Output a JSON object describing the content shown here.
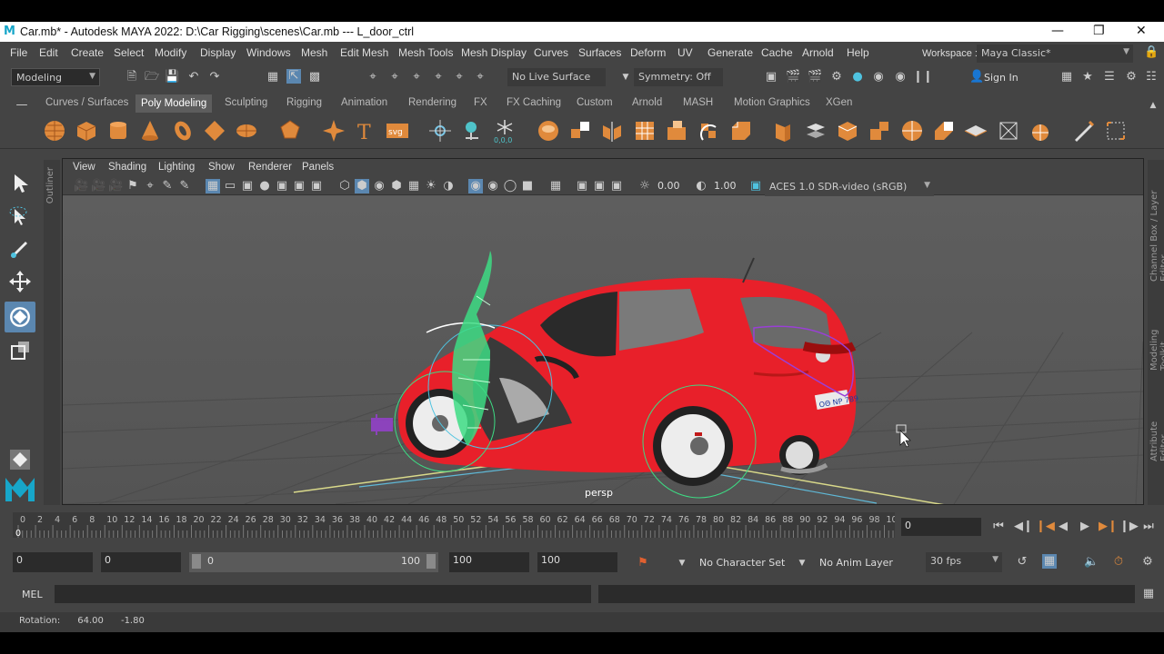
{
  "window": {
    "title": "Car.mb* - Autodesk MAYA 2022: D:\\Car Rigging\\scenes\\Car.mb   ---   L_door_ctrl",
    "logo": "M"
  },
  "menu": [
    "File",
    "Edit",
    "Create",
    "Select",
    "Modify",
    "Display",
    "Windows",
    "Mesh",
    "Edit Mesh",
    "Mesh Tools",
    "Mesh Display",
    "Curves",
    "Surfaces",
    "Deform",
    "UV",
    "Generate",
    "Cache",
    "Arnold",
    "Help"
  ],
  "workspace": {
    "label": "Workspace :",
    "value": "Maya Classic*"
  },
  "statusline": {
    "mode": "Modeling",
    "live_surface": "No Live Surface",
    "symmetry": "Symmetry: Off",
    "sign_in": "Sign In"
  },
  "shelf_tabs": [
    "Curves / Surfaces",
    "Poly Modeling",
    "Sculpting",
    "Rigging",
    "Animation",
    "Rendering",
    "FX",
    "FX Caching",
    "Custom",
    "Arnold",
    "MASH",
    "Motion Graphics",
    "XGen"
  ],
  "shelf_active": "Poly Modeling",
  "shelf_icons": [
    "poly-sphere-icon",
    "poly-cube-icon",
    "poly-cylinder-icon",
    "poly-cone-icon",
    "poly-torus-icon",
    "poly-plane-icon",
    "poly-disc-icon",
    "platonic-solid-icon",
    "super-shape-icon",
    "type-icon",
    "svg-icon",
    "sweep-mesh-icon",
    "pivot-icon",
    "snowflake-icon",
    "combine-icon",
    "separate-icon",
    "mirror-icon",
    "smooth-icon",
    "extrude-icon",
    "bridge-icon",
    "bevel-icon",
    "insert-edge-loop-icon",
    "multi-cut-icon",
    "target-weld-icon",
    "quad-draw-icon",
    "bool-icon",
    "reduce-icon",
    "uv-planar-icon",
    "uv-auto-icon",
    "edit-uv-icon",
    "cut-uv-icon",
    "unfold-icon",
    "brush-icon",
    "layout-icon"
  ],
  "viewport": {
    "menus": [
      "View",
      "Shading",
      "Lighting",
      "Show",
      "Renderer",
      "Panels"
    ],
    "exposure": "0.00",
    "gamma": "1.00",
    "color_space": "ACES 1.0 SDR-video (sRGB)",
    "camera_label": "persp",
    "outliner_tab": "Outliner"
  },
  "right_tabs": [
    "Channel Box / Layer Editor",
    "Modeling Toolkit",
    "Attribute Editor"
  ],
  "timeline": {
    "ticks": [
      "0",
      "2",
      "4",
      "6",
      "8",
      "10",
      "12",
      "14",
      "16",
      "18",
      "20",
      "22",
      "24",
      "26",
      "28",
      "30",
      "32",
      "34",
      "36",
      "38",
      "40",
      "42",
      "44",
      "46",
      "48",
      "50",
      "52",
      "54",
      "56",
      "58",
      "60",
      "62",
      "64",
      "66",
      "68",
      "70",
      "72",
      "74",
      "76",
      "78",
      "80",
      "82",
      "84",
      "86",
      "88",
      "90",
      "92",
      "94",
      "96",
      "98",
      "10"
    ],
    "current_frame": "0",
    "current_field": "0"
  },
  "range": {
    "start": "0",
    "start_inner": "0",
    "slider_min": "0",
    "slider_max": "100",
    "end_inner": "100",
    "end": "100",
    "character_set": "No Character Set",
    "anim_layer": "No Anim Layer",
    "fps": "30 fps"
  },
  "command": {
    "label": "MEL"
  },
  "help": {
    "text": "Rotation:      64.00      -1.80"
  },
  "colors": {
    "car_body": "#e8202a",
    "rig_green": "#3ddc84",
    "rig_purple": "#9a3fd6",
    "maya_blue": "#17a6c9",
    "ui_bg": "#444444",
    "field_bg": "#2b2b2b"
  }
}
